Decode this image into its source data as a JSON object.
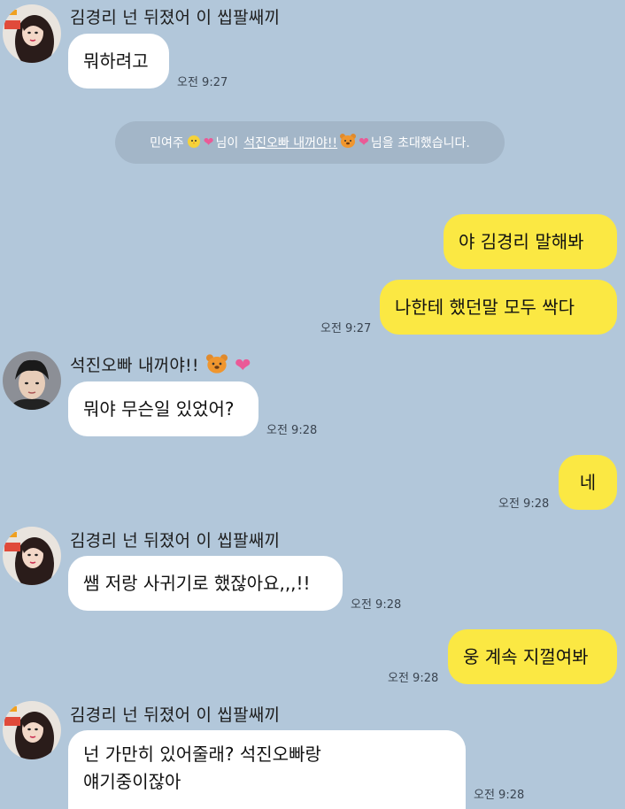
{
  "chat": {
    "system_notice": {
      "inviter": "민여주",
      "middle": "님이",
      "invitee": "석진오빠 내꺼야!!",
      "suffix": "님을 초대했습니다."
    },
    "messages": [
      {
        "sender": "김경리 넌 뒤졌어 이 씹팔쌔끼",
        "text": "뭐하려고",
        "time": "오전 9:27"
      },
      {
        "text": "야 김경리 말해봐"
      },
      {
        "text": "나한테 했던말 모두 싹다",
        "time": "오전 9:27"
      },
      {
        "sender": "석진오빠 내꺼야!!",
        "text": "뭐야 무슨일 있었어?",
        "time": "오전 9:28"
      },
      {
        "text": "네",
        "time": "오전 9:28"
      },
      {
        "sender": "김경리 넌 뒤졌어 이 씹팔쌔끼",
        "text": "쌤 저랑 사귀기로 했잖아요,,,!!",
        "time": "오전 9:28"
      },
      {
        "text": "웅 계속 지껄여봐",
        "time": "오전 9:28"
      },
      {
        "sender": "김경리 넌 뒤졌어 이 씹팔쌔끼",
        "lines": [
          "넌 가만히 있어줄래? 석진오빠랑",
          "얘기중이잖아"
        ],
        "time": "오전 9:28"
      }
    ]
  },
  "colors": {
    "background": "#b2c7da",
    "outgoing_bubble": "#fbe843",
    "incoming_bubble": "#ffffff",
    "heart": "#ea5a97"
  },
  "icons": {
    "avatar_kim": "avatar-kim-icon",
    "avatar_seokjin": "avatar-seokjin-icon",
    "chick": "chick-icon",
    "bear": "bear-face-icon",
    "heart": "heart-icon"
  }
}
